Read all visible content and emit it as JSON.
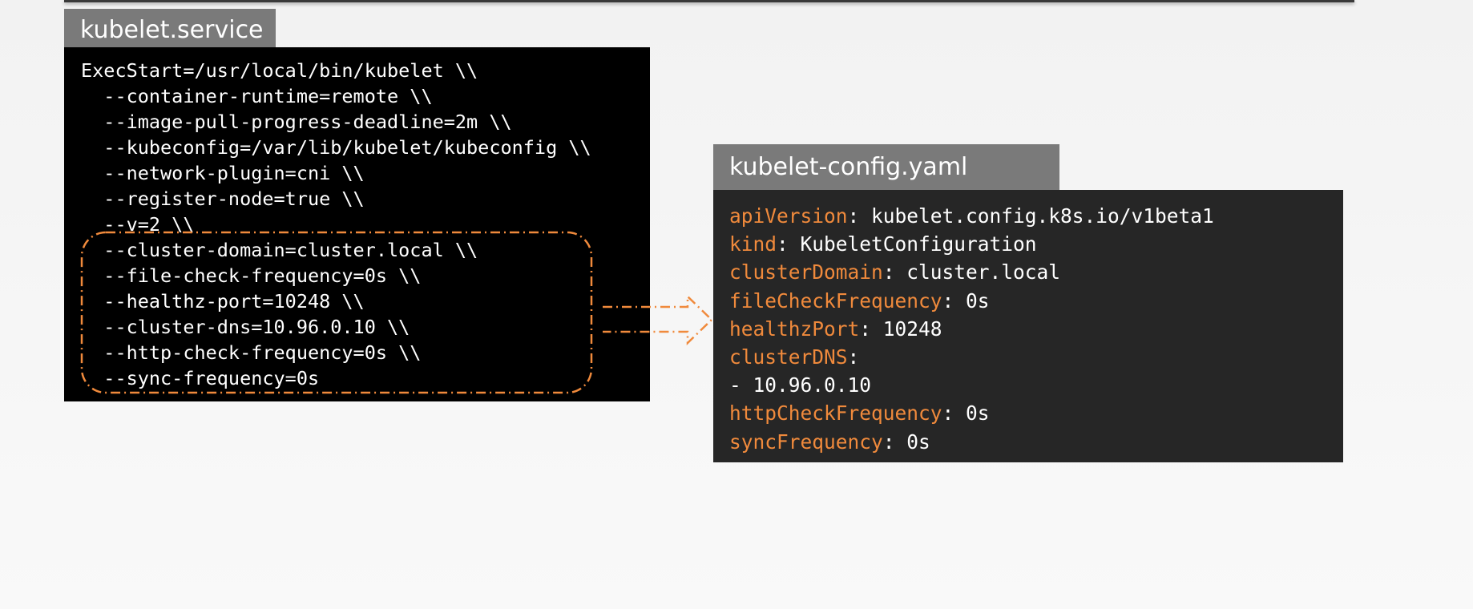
{
  "service": {
    "title": "kubelet.service",
    "lines": [
      "ExecStart=/usr/local/bin/kubelet \\\\",
      "  --container-runtime=remote \\\\",
      "  --image-pull-progress-deadline=2m \\\\",
      "  --kubeconfig=/var/lib/kubelet/kubeconfig \\\\",
      "  --network-plugin=cni \\\\",
      "  --register-node=true \\\\",
      "  --v=2 \\\\",
      "  --cluster-domain=cluster.local \\\\",
      "  --file-check-frequency=0s \\\\",
      "  --healthz-port=10248 \\\\",
      "  --cluster-dns=10.96.0.10 \\\\",
      "  --http-check-frequency=0s \\\\",
      "  --sync-frequency=0s"
    ]
  },
  "config": {
    "title": "kubelet-config.yaml",
    "lines": [
      {
        "key": "apiVersion",
        "value": " kubelet.config.k8s.io/v1beta1"
      },
      {
        "key": "kind",
        "value": " KubeletConfiguration"
      },
      {
        "key": "clusterDomain",
        "value": " cluster.local"
      },
      {
        "key": "fileCheckFrequency",
        "value": " 0s"
      },
      {
        "key": "healthzPort",
        "value": " 10248"
      },
      {
        "key": "clusterDNS",
        "value": ""
      },
      {
        "key": "",
        "value": "- 10.96.0.10"
      },
      {
        "key": "httpCheckFrequency",
        "value": " 0s"
      },
      {
        "key": "syncFrequency",
        "value": " 0s"
      }
    ]
  },
  "colors": {
    "highlight": "#f08a3c",
    "service_bg": "#000000",
    "config_bg": "#262626",
    "title_bg": "#7a7a7a"
  }
}
